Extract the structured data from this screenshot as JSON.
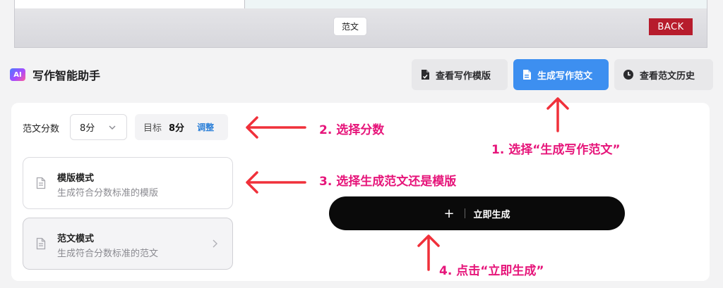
{
  "top_frame": {
    "essay_chip": "范文",
    "back_button": "BACK"
  },
  "header": {
    "badge": "AI",
    "title": "写作智能助手",
    "tabs": [
      {
        "label": "查看写作模版",
        "icon": "document-icon"
      },
      {
        "label": "生成写作范文",
        "icon": "document-icon",
        "active": true
      },
      {
        "label": "查看范文历史",
        "icon": "clock-icon"
      }
    ]
  },
  "settings": {
    "score_label": "范文分数",
    "score_value": "8分",
    "target_label": "目标",
    "target_value": "8分",
    "adjust_label": "调整"
  },
  "modes": [
    {
      "title": "模版模式",
      "subtitle": "生成符合分数标准的模版"
    },
    {
      "title": "范文模式",
      "subtitle": "生成符合分数标准的范文"
    }
  ],
  "generate_button": {
    "plus": "+",
    "label": "立即生成"
  },
  "annotations": {
    "step1": "1. 选择“生成写作范文”",
    "step2": "2. 选择分数",
    "step3": "3. 选择生成范文还是模版",
    "step4": "4. 点击“立即生成”"
  },
  "colors": {
    "accent_blue": "#3d8ff0",
    "annotation_pink": "#e6157a",
    "arrow_red": "#f0303a",
    "back_red": "#b71c2c"
  }
}
